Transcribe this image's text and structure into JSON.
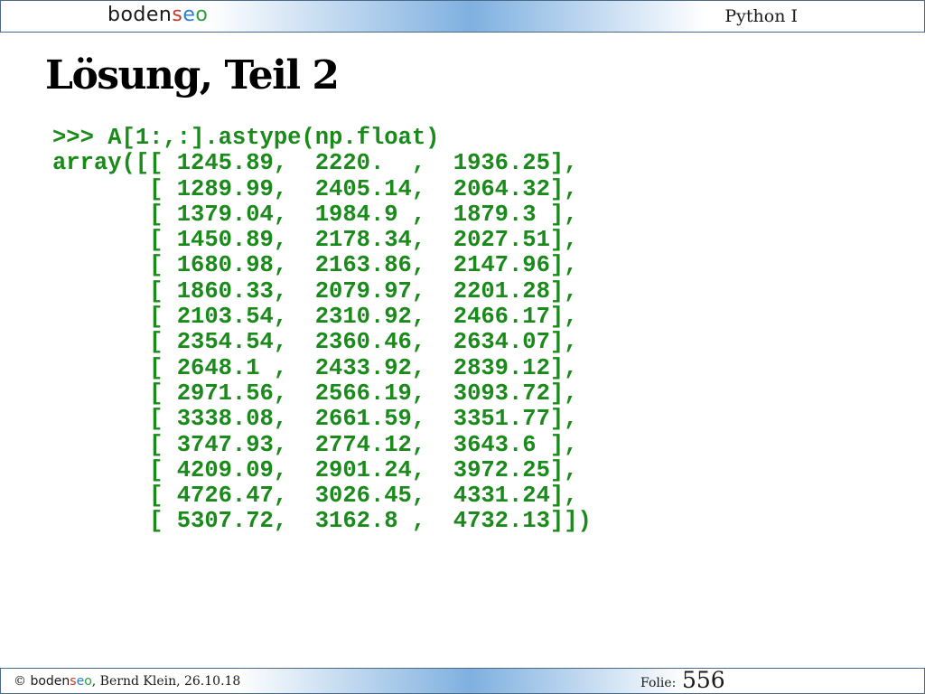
{
  "header": {
    "logo_parts": [
      "boden",
      "s",
      "e",
      "o"
    ],
    "course": "Python I"
  },
  "slide": {
    "title": "Lösung, Teil 2",
    "code_lines": [
      ">>> A[1:,:].astype(np.float)",
      "array([[ 1245.89,  2220.  ,  1936.25],",
      "       [ 1289.99,  2405.14,  2064.32],",
      "       [ 1379.04,  1984.9 ,  1879.3 ],",
      "       [ 1450.89,  2178.34,  2027.51],",
      "       [ 1680.98,  2163.86,  2147.96],",
      "       [ 1860.33,  2079.97,  2201.28],",
      "       [ 2103.54,  2310.92,  2466.17],",
      "       [ 2354.54,  2360.46,  2634.07],",
      "       [ 2648.1 ,  2433.92,  2839.12],",
      "       [ 2971.56,  2566.19,  3093.72],",
      "       [ 3338.08,  2661.59,  3351.77],",
      "       [ 3747.93,  2774.12,  3643.6 ],",
      "       [ 4209.09,  2901.24,  3972.25],",
      "       [ 4726.47,  3026.45,  4331.24],",
      "       [ 5307.72,  3162.8 ,  4732.13]])"
    ]
  },
  "footer": {
    "copyright_symbol": "©",
    "logo_parts": [
      "boden",
      "s",
      "e",
      "o"
    ],
    "author_date": ", Bernd Klein, 26.10.18",
    "folie_label": "Folie:",
    "folie_number": "556"
  },
  "colors": {
    "code_green": "#1a8a1a",
    "header_blue": "#7fb0e0"
  }
}
